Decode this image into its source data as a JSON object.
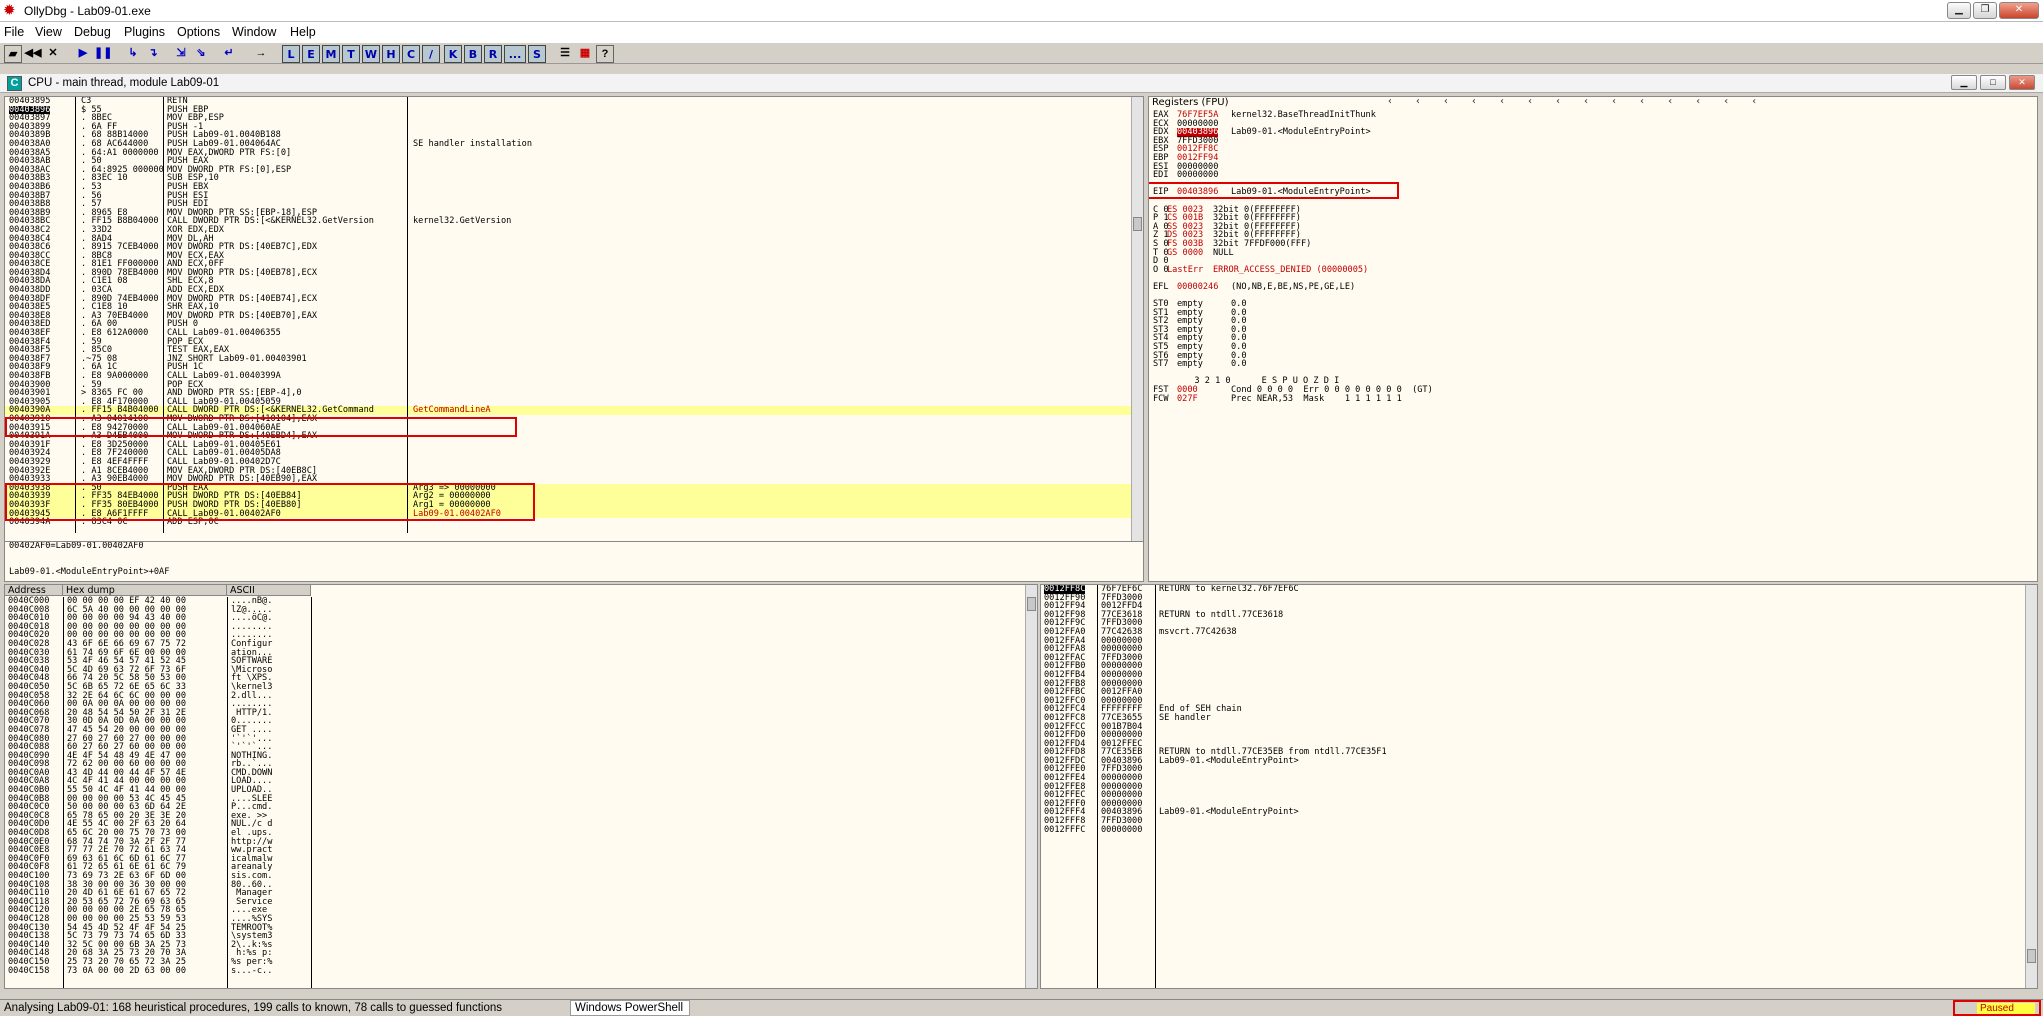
{
  "title": "OllyDbg - Lab09-01.exe",
  "menu": [
    "File",
    "View",
    "Debug",
    "Plugins",
    "Options",
    "Window",
    "Help"
  ],
  "toolbar_letters": [
    "L",
    "E",
    "M",
    "T",
    "W",
    "H",
    "C",
    "/",
    "K",
    "B",
    "R",
    "...",
    "S"
  ],
  "cpu_title": "CPU - main thread, module Lab09-01",
  "disasm": [
    [
      "00403895",
      "C3",
      "RETN",
      ""
    ],
    [
      "00403896",
      "$ 55",
      "PUSH EBP",
      ""
    ],
    [
      "00403897",
      ". 8BEC",
      "MOV EBP,ESP",
      ""
    ],
    [
      "00403899",
      ". 6A FF",
      "PUSH -1",
      ""
    ],
    [
      "0040389B",
      ". 68 88B14000",
      "PUSH Lab09-01.0040B188",
      ""
    ],
    [
      "004038A0",
      ". 68 AC644000",
      "PUSH Lab09-01.004064AC",
      "SE handler installation"
    ],
    [
      "004038A5",
      ". 64:A1 0000000",
      "MOV EAX,DWORD PTR FS:[0]",
      ""
    ],
    [
      "004038AB",
      ". 50",
      "PUSH EAX",
      ""
    ],
    [
      "004038AC",
      ". 64:8925 000000",
      "MOV DWORD PTR FS:[0],ESP",
      ""
    ],
    [
      "004038B3",
      ". 83EC 10",
      "SUB ESP,10",
      ""
    ],
    [
      "004038B6",
      ". 53",
      "PUSH EBX",
      ""
    ],
    [
      "004038B7",
      ". 56",
      "PUSH ESI",
      ""
    ],
    [
      "004038B8",
      ". 57",
      "PUSH EDI",
      ""
    ],
    [
      "004038B9",
      ". 8965 E8",
      "MOV DWORD PTR SS:[EBP-18],ESP",
      ""
    ],
    [
      "004038BC",
      ". FF15 B8B04000",
      "CALL DWORD PTR DS:[<&KERNEL32.GetVersion",
      "kernel32.GetVersion"
    ],
    [
      "004038C2",
      ". 33D2",
      "XOR EDX,EDX",
      ""
    ],
    [
      "004038C4",
      ". 8AD4",
      "MOV DL,AH",
      ""
    ],
    [
      "004038C6",
      ". 8915 7CEB4000",
      "MOV DWORD PTR DS:[40EB7C],EDX",
      ""
    ],
    [
      "004038CC",
      ". 8BC8",
      "MOV ECX,EAX",
      ""
    ],
    [
      "004038CE",
      ". 81E1 FF000000",
      "AND ECX,0FF",
      ""
    ],
    [
      "004038D4",
      ". 890D 78EB4000",
      "MOV DWORD PTR DS:[40EB78],ECX",
      ""
    ],
    [
      "004038DA",
      ". C1E1 08",
      "SHL ECX,8",
      ""
    ],
    [
      "004038DD",
      ". 03CA",
      "ADD ECX,EDX",
      ""
    ],
    [
      "004038DF",
      ". 890D 74EB4000",
      "MOV DWORD PTR DS:[40EB74],ECX",
      ""
    ],
    [
      "004038E5",
      ". C1E8 10",
      "SHR EAX,10",
      ""
    ],
    [
      "004038E8",
      ". A3 70EB4000",
      "MOV DWORD PTR DS:[40EB70],EAX",
      ""
    ],
    [
      "004038ED",
      ". 6A 00",
      "PUSH 0",
      ""
    ],
    [
      "004038EF",
      ". E8 612A0000",
      "CALL Lab09-01.00406355",
      ""
    ],
    [
      "004038F4",
      ". 59",
      "POP ECX",
      ""
    ],
    [
      "004038F5",
      ". 85C0",
      "TEST EAX,EAX",
      ""
    ],
    [
      "004038F7",
      ".~75 08",
      "JNZ SHORT Lab09-01.00403901",
      ""
    ],
    [
      "004038F9",
      ". 6A 1C",
      "PUSH 1C",
      ""
    ],
    [
      "004038FB",
      ". E8 9A000000",
      "CALL Lab09-01.0040399A",
      ""
    ],
    [
      "00403900",
      ". 59",
      "POP ECX",
      ""
    ],
    [
      "00403901",
      "> 8365 FC 00",
      "AND DWORD PTR SS:[EBP-4],0",
      ""
    ],
    [
      "00403905",
      ". E8 4F170000",
      "CALL Lab09-01.00405059",
      ""
    ],
    [
      "0040390A",
      ". FF15 B4B04000",
      "CALL DWORD PTR DS:[<&KERNEL32.GetCommand",
      "GetCommandLineA"
    ],
    [
      "00403910",
      ". A3 04014100",
      "MOV DWORD PTR DS:[410104],EAX",
      ""
    ],
    [
      "00403915",
      ". E8 94270000",
      "CALL Lab09-01.004060AE",
      ""
    ],
    [
      "0040391A",
      ". A3 D4EB4000",
      "MOV DWORD PTR DS:[40EBD4],EAX",
      ""
    ],
    [
      "0040391F",
      ". E8 3D250000",
      "CALL Lab09-01.00405E61",
      ""
    ],
    [
      "00403924",
      ". E8 7F240000",
      "CALL Lab09-01.00405DA8",
      ""
    ],
    [
      "00403929",
      ". E8 4EF4FFFF",
      "CALL Lab09-01.00402D7C",
      ""
    ],
    [
      "0040392E",
      ". A1 8CEB4000",
      "MOV EAX,DWORD PTR DS:[40EB8C]",
      ""
    ],
    [
      "00403933",
      ". A3 90EB4000",
      "MOV DWORD PTR DS:[40EB90],EAX",
      ""
    ],
    [
      "00403938",
      ". 50",
      "PUSH EAX",
      "Arg3 => 00000000"
    ],
    [
      "00403939",
      ". FF35 84EB4000",
      "PUSH DWORD PTR DS:[40EB84]",
      "Arg2 = 00000000"
    ],
    [
      "0040393F",
      ". FF35 80EB4000",
      "PUSH DWORD PTR DS:[40EB80]",
      "Arg1 = 00000000"
    ],
    [
      "00403945",
      ". E8 A6F1FFFF",
      "CALL Lab09-01.00402AF0",
      "Lab09-01.00402AF0"
    ],
    [
      "0040394A",
      ". 83C4 0C",
      "ADD ESP,0C",
      ""
    ]
  ],
  "info": [
    "00402AF0=Lab09-01.00402AF0",
    "",
    "Lab09-01.<ModuleEntryPoint>+0AF"
  ],
  "registers_header": "Registers (FPU)",
  "registers": [
    [
      "EAX",
      "76F7EF5A",
      "kernel32.BaseThreadInitThunk"
    ],
    [
      "ECX",
      "00000000",
      ""
    ],
    [
      "EDX",
      "00403896",
      "Lab09-01.<ModuleEntryPoint>"
    ],
    [
      "EBX",
      "7FFD3000",
      ""
    ],
    [
      "ESP",
      "0012FF8C",
      ""
    ],
    [
      "EBP",
      "0012FF94",
      ""
    ],
    [
      "ESI",
      "00000000",
      ""
    ],
    [
      "EDI",
      "00000000",
      ""
    ],
    [
      "",
      "",
      ""
    ],
    [
      "EIP",
      "00403896",
      "Lab09-01.<ModuleEntryPoint>"
    ],
    [
      "",
      "",
      ""
    ],
    [
      "C 0",
      "ES 0023",
      "32bit 0(FFFFFFFF)"
    ],
    [
      "P 1",
      "CS 001B",
      "32bit 0(FFFFFFFF)"
    ],
    [
      "A 0",
      "SS 0023",
      "32bit 0(FFFFFFFF)"
    ],
    [
      "Z 1",
      "DS 0023",
      "32bit 0(FFFFFFFF)"
    ],
    [
      "S 0",
      "FS 003B",
      "32bit 7FFDF000(FFF)"
    ],
    [
      "T 0",
      "GS 0000",
      "NULL"
    ],
    [
      "D 0",
      "",
      ""
    ],
    [
      "O 0",
      "LastErr",
      "ERROR_ACCESS_DENIED (00000005)"
    ],
    [
      "",
      "",
      ""
    ],
    [
      "EFL",
      "00000246",
      "(NO,NB,E,BE,NS,PE,GE,LE)"
    ],
    [
      "",
      "",
      ""
    ],
    [
      "ST0",
      "empty",
      "0.0"
    ],
    [
      "ST1",
      "empty",
      "0.0"
    ],
    [
      "ST2",
      "empty",
      "0.0"
    ],
    [
      "ST3",
      "empty",
      "0.0"
    ],
    [
      "ST4",
      "empty",
      "0.0"
    ],
    [
      "ST5",
      "empty",
      "0.0"
    ],
    [
      "ST6",
      "empty",
      "0.0"
    ],
    [
      "ST7",
      "empty",
      "0.0"
    ],
    [
      "",
      "",
      ""
    ],
    [
      "",
      "",
      "        3 2 1 0      E S P U O Z D I"
    ],
    [
      "FST",
      "0000",
      "Cond 0 0 0 0  Err 0 0 0 0 0 0 0 0  (GT)"
    ],
    [
      "FCW",
      "027F",
      "Prec NEAR,53  Mask    1 1 1 1 1 1"
    ]
  ],
  "dump_headers": [
    "Address",
    "Hex dump",
    "ASCII"
  ],
  "dump": [
    [
      "0040C000",
      "00 00 00 00 EF 42 40 00",
      "....nB@."
    ],
    [
      "0040C008",
      "6C 5A 40 00 00 00 00 00",
      "lZ@....."
    ],
    [
      "0040C010",
      "00 00 00 00 94 43 40 00",
      "....öC@."
    ],
    [
      "0040C018",
      "00 00 00 00 00 00 00 00",
      "........"
    ],
    [
      "0040C020",
      "00 00 00 00 00 00 00 00",
      "........"
    ],
    [
      "0040C028",
      "43 6F 6E 66 69 67 75 72",
      "Configur"
    ],
    [
      "0040C030",
      "61 74 69 6F 6E 00 00 00",
      "ation..."
    ],
    [
      "0040C038",
      "53 4F 46 54 57 41 52 45",
      "SOFTWARE"
    ],
    [
      "0040C040",
      "5C 4D 69 63 72 6F 73 6F",
      "\\Microso"
    ],
    [
      "0040C048",
      "66 74 20 5C 58 50 53 00",
      "ft \\XPS."
    ],
    [
      "0040C050",
      "5C 6B 65 72 6E 65 6C 33",
      "\\kernel3"
    ],
    [
      "0040C058",
      "32 2E 64 6C 6C 00 00 00",
      "2.dll..."
    ],
    [
      "0040C060",
      "00 0A 00 0A 00 00 00 00",
      "........"
    ],
    [
      "0040C068",
      "20 48 54 54 50 2F 31 2E",
      " HTTP/1."
    ],
    [
      "0040C070",
      "30 0D 0A 0D 0A 00 00 00",
      "0......."
    ],
    [
      "0040C078",
      "47 45 54 20 00 00 00 00",
      "GET ...."
    ],
    [
      "0040C080",
      "27 60 27 60 27 00 00 00",
      "'`'`'..."
    ],
    [
      "0040C088",
      "60 27 60 27 60 00 00 00",
      "`'`'`..."
    ],
    [
      "0040C090",
      "4E 4F 54 48 49 4E 47 00",
      "NOTHING."
    ],
    [
      "0040C098",
      "72 62 00 00 60 00 00 00",
      "rb..`..."
    ],
    [
      "0040C0A0",
      "43 4D 44 00 44 4F 57 4E",
      "CMD.DOWN"
    ],
    [
      "0040C0A8",
      "4C 4F 41 44 00 00 00 00",
      "LOAD...."
    ],
    [
      "0040C0B0",
      "55 50 4C 4F 41 44 00 00",
      "UPLOAD.."
    ],
    [
      "0040C0B8",
      "00 00 00 00 53 4C 45 45",
      "....SLEE"
    ],
    [
      "0040C0C0",
      "50 00 00 00 63 6D 64 2E",
      "P...cmd."
    ],
    [
      "0040C0C8",
      "65 78 65 00 20 3E 3E 20",
      "exe. >> "
    ],
    [
      "0040C0D0",
      "4E 55 4C 00 2F 63 20 64",
      "NUL./c d"
    ],
    [
      "0040C0D8",
      "65 6C 20 00 75 70 73 00",
      "el .ups."
    ],
    [
      "0040C0E0",
      "68 74 74 70 3A 2F 2F 77",
      "http://w"
    ],
    [
      "0040C0E8",
      "77 77 2E 70 72 61 63 74",
      "ww.pract"
    ],
    [
      "0040C0F0",
      "69 63 61 6C 6D 61 6C 77",
      "icalmalw"
    ],
    [
      "0040C0F8",
      "61 72 65 61 6E 61 6C 79",
      "areanaly"
    ],
    [
      "0040C100",
      "73 69 73 2E 63 6F 6D 00",
      "sis.com."
    ],
    [
      "0040C108",
      "38 30 00 00 36 30 00 00",
      "80..60.."
    ],
    [
      "0040C110",
      "20 4D 61 6E 61 67 65 72",
      " Manager"
    ],
    [
      "0040C118",
      "20 53 65 72 76 69 63 65",
      " Service"
    ],
    [
      "0040C120",
      "00 00 00 00 2E 65 78 65",
      "....exe"
    ],
    [
      "0040C128",
      "00 00 00 00 25 53 59 53",
      "....%SYS"
    ],
    [
      "0040C130",
      "54 45 4D 52 4F 4F 54 25",
      "TEMROOT%"
    ],
    [
      "0040C138",
      "5C 73 79 73 74 65 6D 33",
      "\\system3"
    ],
    [
      "0040C140",
      "32 5C 00 00 6B 3A 25 73",
      "2\\..k:%s"
    ],
    [
      "0040C148",
      "20 68 3A 25 73 20 70 3A",
      " h:%s p:"
    ],
    [
      "0040C150",
      "25 73 20 70 65 72 3A 25",
      "%s per:%"
    ],
    [
      "0040C158",
      "73 0A 00 00 2D 63 00 00",
      "s...-c.."
    ]
  ],
  "stack": [
    [
      "0012FF8C",
      "76F7EF6C",
      "RETURN to kernel32.76F7EF6C"
    ],
    [
      "0012FF90",
      "7FFD3000",
      ""
    ],
    [
      "0012FF94",
      "0012FFD4",
      ""
    ],
    [
      "0012FF98",
      "77CE3618",
      "RETURN to ntdll.77CE3618"
    ],
    [
      "0012FF9C",
      "7FFD3000",
      ""
    ],
    [
      "0012FFA0",
      "77C42638",
      "msvcrt.77C42638"
    ],
    [
      "0012FFA4",
      "00000000",
      ""
    ],
    [
      "0012FFA8",
      "00000000",
      ""
    ],
    [
      "0012FFAC",
      "7FFD3000",
      ""
    ],
    [
      "0012FFB0",
      "00000000",
      ""
    ],
    [
      "0012FFB4",
      "00000000",
      ""
    ],
    [
      "0012FFB8",
      "00000000",
      ""
    ],
    [
      "0012FFBC",
      "0012FFA0",
      ""
    ],
    [
      "0012FFC0",
      "00000000",
      ""
    ],
    [
      "0012FFC4",
      "FFFFFFFF",
      "End of SEH chain"
    ],
    [
      "0012FFC8",
      "77CE3655",
      "SE handler"
    ],
    [
      "0012FFCC",
      "001B7B04",
      ""
    ],
    [
      "0012FFD0",
      "00000000",
      ""
    ],
    [
      "0012FFD4",
      "0012FFEC",
      ""
    ],
    [
      "0012FFD8",
      "77CE35EB",
      "RETURN to ntdll.77CE35EB from ntdll.77CE35F1"
    ],
    [
      "0012FFDC",
      "00403896",
      "Lab09-01.<ModuleEntryPoint>"
    ],
    [
      "0012FFE0",
      "7FFD3000",
      ""
    ],
    [
      "0012FFE4",
      "00000000",
      ""
    ],
    [
      "0012FFE8",
      "00000000",
      ""
    ],
    [
      "0012FFEC",
      "00000000",
      ""
    ],
    [
      "0012FFF0",
      "00000000",
      ""
    ],
    [
      "0012FFF4",
      "00403896",
      "Lab09-01.<ModuleEntryPoint>"
    ],
    [
      "0012FFF8",
      "7FFD3000",
      ""
    ],
    [
      "0012FFFC",
      "00000000",
      ""
    ]
  ],
  "status": "Analysing Lab09-01: 168 heuristical procedures, 199 calls to known, 78 calls to guessed functions",
  "taskbar": "Windows PowerShell",
  "paused": "Paused"
}
